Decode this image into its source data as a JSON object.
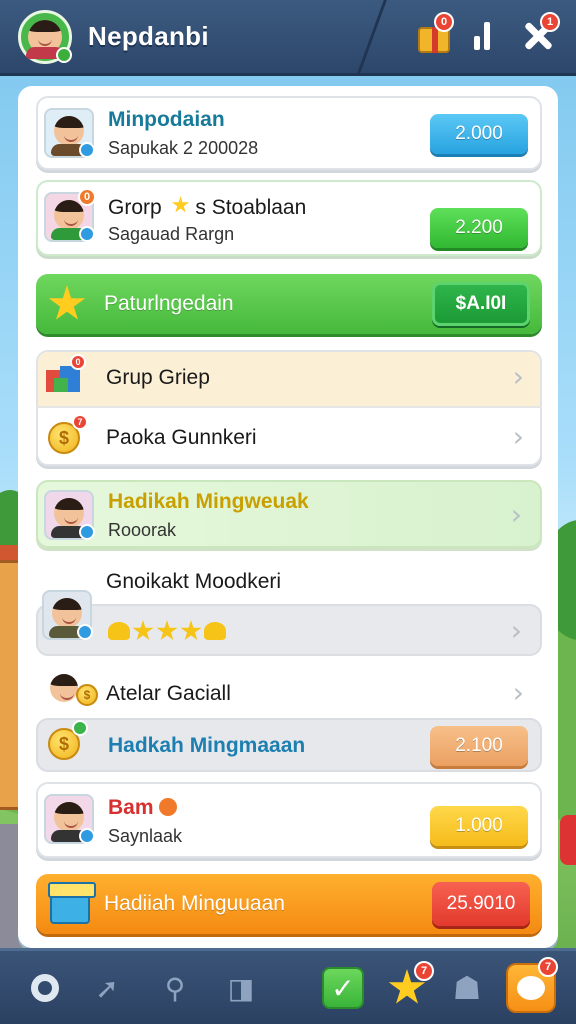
{
  "header": {
    "player_name": "Nepdanbi",
    "gift_notif": "0",
    "close_notif": "1"
  },
  "rows": [
    {
      "title": "Minpodaian",
      "subtitle": "Sapukak 2 200028",
      "value": "2.000"
    },
    {
      "title": "Grorp",
      "title_suffix": "s Stoablaan",
      "subtitle": "Sagauad Rargn",
      "value": "2.200"
    },
    {
      "title": "Paturlngedain",
      "value": "$A.I0I"
    },
    {
      "title": "Grup Griep"
    },
    {
      "title": "Paoka Gunnkeri"
    },
    {
      "title": "Hadikah Mingweuak",
      "subtitle": "Rooorak"
    },
    {
      "title": "Gnoikakt Moodkeri"
    },
    {
      "title": "Atelar Gaciall"
    },
    {
      "title": "Hadkah Mingmaaan",
      "value": "2.100"
    },
    {
      "title": "Bam",
      "subtitle": "Saynlaak",
      "value": "1.000"
    },
    {
      "title": "Hadiiah Minguuaan",
      "value": "25.9010"
    }
  ],
  "notifs": {
    "row2_avatar": "0",
    "row4_icon": "0",
    "row5_icon": "7",
    "nav_star": "7",
    "nav_orange": "7"
  },
  "colors": {
    "topbar": "#3c5a80",
    "green_banner": "#45b93b",
    "orange_banner": "#f48a12",
    "blue_button": "#27a3e0",
    "green_button": "#31b832"
  },
  "icons": [
    "gift-icon",
    "bars-icon",
    "close-icon",
    "star-icon",
    "coin-icon",
    "cubes-icon",
    "shop-icon",
    "home-icon",
    "arrow-icon",
    "profile-icon",
    "chat-icon",
    "check-icon",
    "ghost-icon",
    "chevron-right-icon"
  ]
}
